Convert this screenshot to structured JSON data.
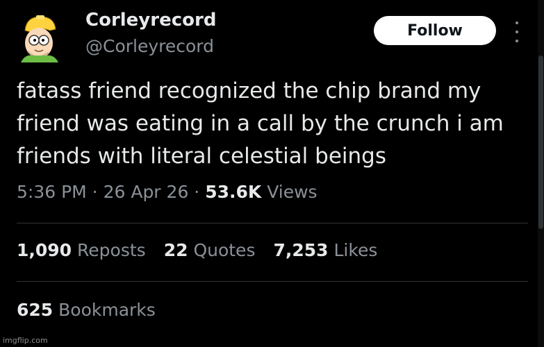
{
  "author": {
    "display_name": "Corleyrecord",
    "handle": "@Corleyrecord",
    "avatar_icon": "cartoon-avatar-icon"
  },
  "follow_label": "Follow",
  "more_icon": "more-options-icon",
  "tweet_lines": [
    "fatass friend recognized the chip brand my",
    "friend was eating in a call by the crunch i am",
    "friends with literal celestial beings"
  ],
  "meta": {
    "time": "5:36 PM",
    "sep1": " · ",
    "date": "26 Apr 26",
    "sep2": " · ",
    "views_count": "53.6K",
    "views_label": " Views"
  },
  "stats": {
    "reposts_count": "1,090",
    "reposts_label": "Reposts",
    "quotes_count": "22",
    "quotes_label": "Quotes",
    "likes_count": "7,253",
    "likes_label": "Likes",
    "bookmarks_count": "625",
    "bookmarks_label": "Bookmarks"
  },
  "watermark": "imgflip.com",
  "colors": {
    "background": "#000000",
    "text_primary": "#e7e9ea",
    "text_secondary": "#8b9197",
    "divider": "#2f3336",
    "button_bg": "#ffffff"
  }
}
